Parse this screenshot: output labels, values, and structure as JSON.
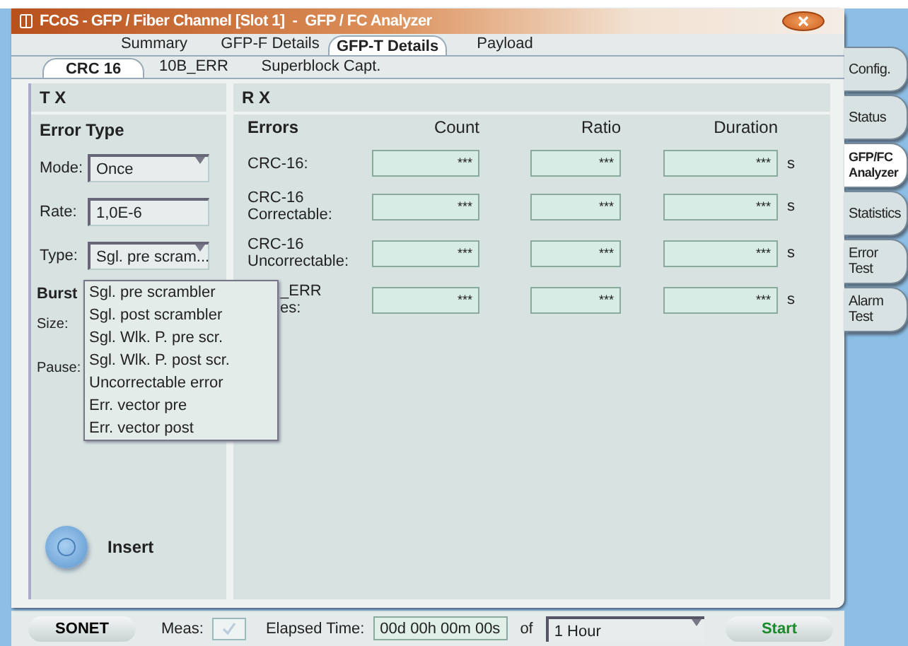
{
  "window": {
    "title": "FCoS - GFP / Fiber Channel [Slot 1]  -  GFP / FC Analyzer"
  },
  "tabs": [
    {
      "label": "Summary",
      "selected": false
    },
    {
      "label": "GFP-F Details",
      "selected": false
    },
    {
      "label": "GFP-T Details",
      "selected": true
    },
    {
      "label": "Payload",
      "selected": false
    }
  ],
  "subtabs": [
    {
      "label": "CRC 16",
      "selected": true
    },
    {
      "label": "10B_ERR",
      "selected": false
    },
    {
      "label": "Superblock Capt.",
      "selected": false
    }
  ],
  "tx": {
    "heading": "T X",
    "section": "Error Type",
    "fields": [
      {
        "label": "Mode:",
        "value": "Once",
        "kind": "dropdown"
      },
      {
        "label": "Rate:",
        "value": "1,0E-6",
        "kind": "text"
      },
      {
        "label": "Type:",
        "value": "Sgl. pre scram...",
        "kind": "dropdown"
      }
    ],
    "burst": {
      "heading": "Burst",
      "fields": [
        "Size:",
        "Pause:"
      ]
    },
    "type_menu": {
      "options": [
        "Sgl. pre scrambler",
        "Sgl. post scrambler",
        "Sgl. Wlk. P. pre scr.",
        "Sgl. Wlk. P. post scr.",
        "Uncorrectable error",
        "Err. vector pre",
        "Err. vector post"
      ]
    },
    "insert": {
      "label": "Insert"
    }
  },
  "rx": {
    "heading": "R X",
    "section": "Errors",
    "columns": [
      "Count",
      "Ratio",
      "Duration"
    ],
    "rows": [
      {
        "label": [
          "CRC-16:"
        ],
        "count": "***",
        "ratio": "***",
        "duration": "***",
        "unit": "s",
        "partly_covered": false
      },
      {
        "label": [
          "CRC-16",
          "Correctable:"
        ],
        "count": "***",
        "ratio": "***",
        "duration": "***",
        "unit": "s",
        "partly_covered": false
      },
      {
        "label": [
          "CRC-16",
          "Uncorrectable:"
        ],
        "count": "***",
        "ratio": "***",
        "duration": "***",
        "unit": "s",
        "partly_covered": false
      },
      {
        "label": [
          "_ERR",
          "es:"
        ],
        "count": "***",
        "ratio": "***",
        "duration": "***",
        "unit": "s",
        "partly_covered": true
      }
    ]
  },
  "side_tabs": [
    {
      "label": "Config.",
      "selected": false
    },
    {
      "label": "Status",
      "selected": false
    },
    {
      "label": "GFP/FC Analyzer",
      "selected": true
    },
    {
      "label": "Statistics",
      "selected": false
    },
    {
      "label": "Error Test",
      "selected": false
    },
    {
      "label": "Alarm Test",
      "selected": false
    }
  ],
  "status_bar": {
    "mode_button": "SONET",
    "meas_label": "Meas:",
    "meas_checked": true,
    "elapsed_label": "Elapsed Time:",
    "elapsed": "00d 00h 00m 00s",
    "of": "of",
    "duration": "1 Hour",
    "start": "Start"
  }
}
